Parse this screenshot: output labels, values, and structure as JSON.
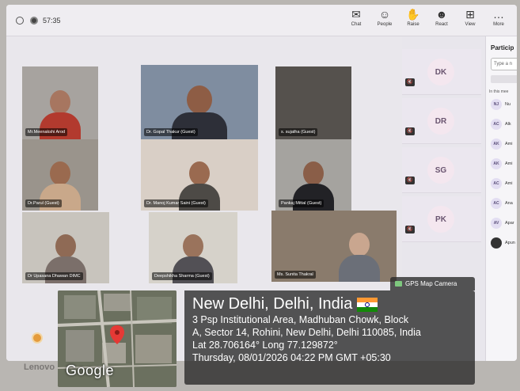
{
  "titlebar": {
    "timer": "57:35",
    "tools": [
      {
        "name": "chat",
        "glyph": "✉",
        "label": "Chat"
      },
      {
        "name": "people",
        "glyph": "☺",
        "label": "People"
      },
      {
        "name": "raise",
        "glyph": "✋",
        "label": "Raise"
      },
      {
        "name": "react",
        "glyph": "☻",
        "label": "React"
      },
      {
        "name": "view",
        "glyph": "⊞",
        "label": "View"
      },
      {
        "name": "more",
        "glyph": "…",
        "label": "More"
      }
    ]
  },
  "tiles": [
    {
      "label": "Mr.Meenakshi Arod",
      "muted": true
    },
    {
      "label": "Dr. Gopal Thakur (Guest)",
      "muted": false
    },
    {
      "label": "s. sujatha (Guest)",
      "muted": true
    },
    {
      "label": "Dr.Parul (Guest)",
      "muted": true
    },
    {
      "label": "Dr. Manoj Kumar Saini (Guest)",
      "muted": true
    },
    {
      "label": "Pankaj Mittal (Guest)",
      "muted": true
    },
    {
      "label": "Dr Upasana Dhawan DIMC",
      "muted": true
    },
    {
      "label": "Deepshikha Sharma (Guest)",
      "muted": true
    },
    {
      "label": "Ms. Sunita Thakral",
      "muted": true
    }
  ],
  "side_tiles": [
    {
      "initials": "DK"
    },
    {
      "initials": "DR"
    },
    {
      "initials": "SG"
    },
    {
      "initials": "PK"
    }
  ],
  "panel": {
    "title": "Particip",
    "search_placeholder": "Type a n",
    "section": "In this mee",
    "rows": [
      {
        "initials": "NJ",
        "name": "Nu"
      },
      {
        "initials": "AC",
        "name": "Alk"
      },
      {
        "initials": "AK",
        "name": "Ami"
      },
      {
        "initials": "AK",
        "name": "Ami"
      },
      {
        "initials": "AC",
        "name": "Ami"
      },
      {
        "initials": "AC",
        "name": "Ana"
      },
      {
        "initials": "AV",
        "name": "Apar"
      },
      {
        "initials": "",
        "name": "Apun"
      }
    ]
  },
  "gps": {
    "badge": "GPS Map Camera",
    "map_logo": "Google",
    "city": "New Delhi, Delhi, India",
    "address_line1": "3 Psp Institutional Area, Madhuban Chowk, Block",
    "address_line2": "A, Sector 14, Rohini, New Delhi, Delhi 110085, India",
    "coords": "Lat 28.706164° Long 77.129872°",
    "datetime": "Thursday, 08/01/2026 04:22 PM GMT +05:30"
  },
  "device": {
    "brand": "Lenovo"
  },
  "colors": {
    "accent": "#6264a7",
    "pin": "#e53935"
  }
}
